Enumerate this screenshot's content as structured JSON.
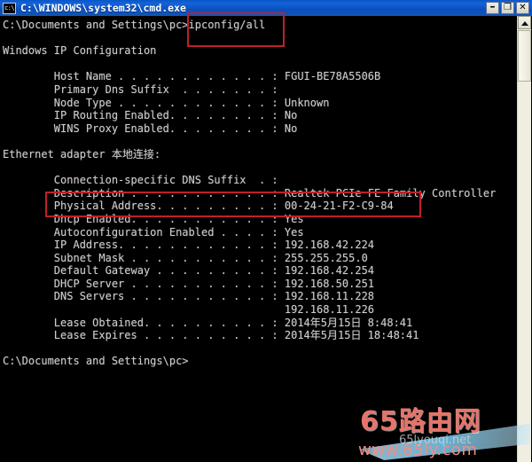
{
  "window": {
    "title": "C:\\WINDOWS\\system32\\cmd.exe",
    "icon_name": "cmd-console-icon",
    "icon_glyph": "c:\\",
    "minimize_label": "–",
    "maximize_label": "❐",
    "close_label": "✕",
    "titlebar_color": "#0b4fbe",
    "background_color": "#000000",
    "text_color": "#cccccc"
  },
  "console": {
    "lines": [
      "C:\\Documents and Settings\\pc>ipconfig/all",
      "",
      "Windows IP Configuration",
      "",
      "        Host Name . . . . . . . . . . . . : FGUI-BE78A5506B",
      "        Primary Dns Suffix  . . . . . . . :",
      "        Node Type . . . . . . . . . . . . : Unknown",
      "        IP Routing Enabled. . . . . . . . : No",
      "        WINS Proxy Enabled. . . . . . . . : No",
      "",
      "Ethernet adapter 本地连接:",
      "",
      "        Connection-specific DNS Suffix  . :",
      "        Description . . . . . . . . . . . : Realtek PCIe FE Family Controller",
      "        Physical Address. . . . . . . . . : 00-24-21-F2-C9-84",
      "        Dhcp Enabled. . . . . . . . . . . : Yes",
      "        Autoconfiguration Enabled . . . . : Yes",
      "        IP Address. . . . . . . . . . . . : 192.168.42.224",
      "        Subnet Mask . . . . . . . . . . . : 255.255.255.0",
      "        Default Gateway . . . . . . . . . : 192.168.42.254",
      "        DHCP Server . . . . . . . . . . . : 192.168.50.251",
      "        DNS Servers . . . . . . . . . . . : 192.168.11.228",
      "                                            192.168.11.226",
      "        Lease Obtained. . . . . . . . . . : 2014年5月15日 8:48:41",
      "        Lease Expires . . . . . . . . . . : 2014年5月15日 18:48:41",
      "",
      "C:\\Documents and Settings\\pc>"
    ],
    "command_typed": "ipconfig/all",
    "prompt": "C:\\Documents and Settings\\pc>"
  },
  "annotations": {
    "color": "#c0202a",
    "boxes": [
      {
        "name": "command-highlight",
        "target": "ipconfig/all"
      },
      {
        "name": "mac-address-highlight",
        "target": "Physical Address. . . . . . . . . : 00-24-21-F2-C9-84"
      }
    ]
  },
  "scrollbar": {
    "up_arrow": "▲",
    "orientation": "vertical"
  },
  "watermark": {
    "main": "65路由网",
    "sub": "www.65ly.com",
    "sub_net": "65lyouqi.net",
    "main_color": "#e8736b"
  }
}
